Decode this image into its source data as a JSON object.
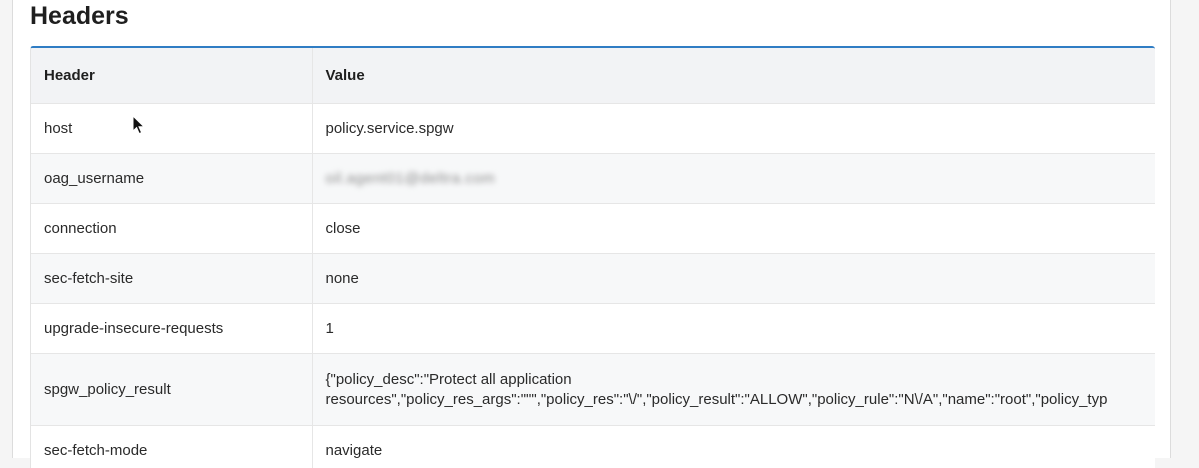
{
  "section": {
    "title": "Headers"
  },
  "table": {
    "columns": [
      "Header",
      "Value"
    ],
    "rows": [
      {
        "header": "host",
        "value": "policy.service.spgw"
      },
      {
        "header": "oag_username",
        "value": "oil.agent01@deltra.com",
        "redacted": true
      },
      {
        "header": "connection",
        "value": "close"
      },
      {
        "header": "sec-fetch-site",
        "value": "none"
      },
      {
        "header": "upgrade-insecure-requests",
        "value": "1"
      },
      {
        "header": "spgw_policy_result",
        "value_line1": "{\"policy_desc\":\"Protect all application",
        "value_line2": "resources\",\"policy_res_args\":\"\"\",\"policy_res\":\"\\/\",\"policy_result\":\"ALLOW\",\"policy_rule\":\"N\\/A\",\"name\":\"root\",\"policy_typ"
      },
      {
        "header": "sec-fetch-mode",
        "value": "navigate"
      }
    ]
  },
  "cursor": {
    "icon": "mouse-pointer-icon"
  }
}
